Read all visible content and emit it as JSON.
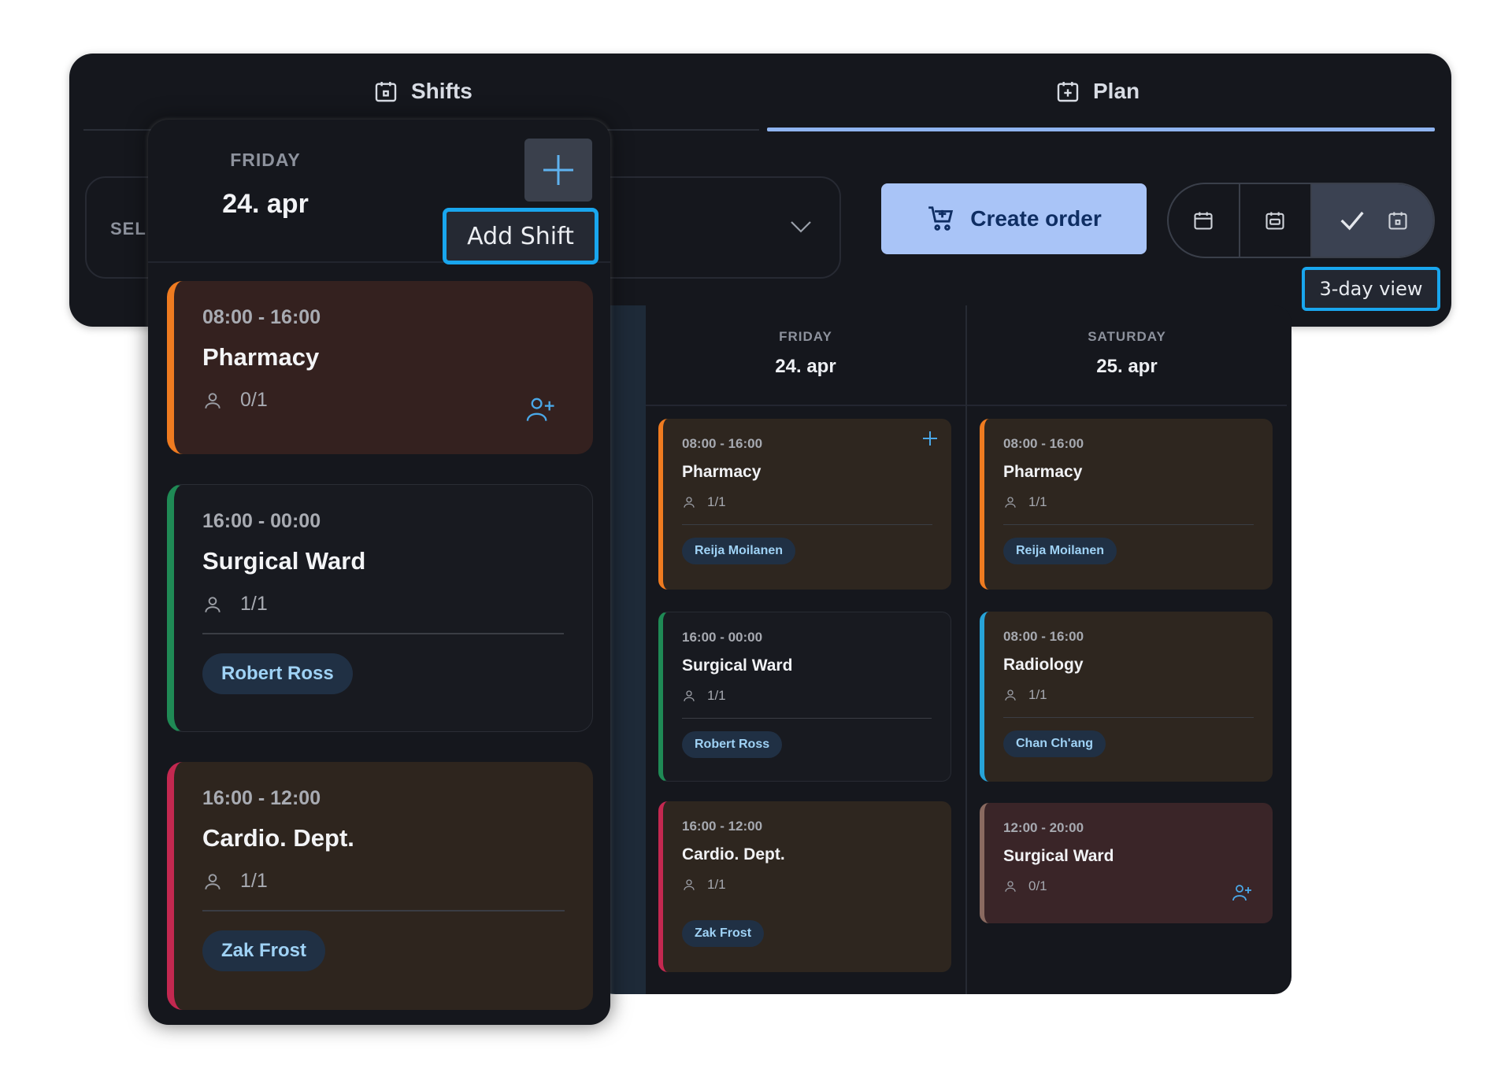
{
  "tabs": [
    {
      "label": "Shifts",
      "icon": "calendar-day-icon"
    },
    {
      "label": "Plan",
      "icon": "calendar-plus-icon"
    }
  ],
  "toolbar": {
    "select_label": "SEL",
    "create_order_label": "Create order",
    "view_tooltip": "3-day view",
    "view_buttons": [
      "calendar-month-icon",
      "calendar-week-icon",
      "check-icon",
      "calendar-day-icon"
    ]
  },
  "detail": {
    "day_name": "FRIDAY",
    "date": "24. apr",
    "add_tooltip": "Add Shift",
    "shifts": [
      {
        "time": "08:00 - 16:00",
        "title": "Pharmacy",
        "count": "0/1",
        "assignee": ""
      },
      {
        "time": "16:00 - 00:00",
        "title": "Surgical Ward",
        "count": "1/1",
        "assignee": "Robert Ross"
      },
      {
        "time": "16:00 - 12:00",
        "title": "Cardio. Dept.",
        "count": "1/1",
        "assignee": "Zak Frost"
      }
    ]
  },
  "grid": {
    "days": [
      {
        "day_name": "FRIDAY",
        "date": "24. apr",
        "shifts": [
          {
            "time": "08:00 - 16:00",
            "title": "Pharmacy",
            "count": "1/1",
            "assignee": "Reija Moilanen"
          },
          {
            "time": "16:00 - 00:00",
            "title": "Surgical Ward",
            "count": "1/1",
            "assignee": "Robert Ross"
          },
          {
            "time": "16:00 - 12:00",
            "title": "Cardio. Dept.",
            "count": "1/1",
            "assignee": "Zak Frost"
          }
        ]
      },
      {
        "day_name": "SATURDAY",
        "date": "25. apr",
        "shifts": [
          {
            "time": "08:00 - 16:00",
            "title": "Pharmacy",
            "count": "1/1",
            "assignee": "Reija Moilanen"
          },
          {
            "time": "08:00 - 16:00",
            "title": "Radiology",
            "count": "1/1",
            "assignee": "Chan Ch'ang"
          },
          {
            "time": "12:00 - 20:00",
            "title": "Surgical Ward",
            "count": "0/1",
            "assignee": ""
          }
        ]
      }
    ]
  },
  "colors": {
    "accent_blue": "#a9c4f7",
    "tooltip_border": "#19a6ee",
    "pharmacy": "#ef7b20",
    "surgical": "#1f8a55",
    "cardio": "#c32850",
    "radiology": "#27a3d8"
  }
}
